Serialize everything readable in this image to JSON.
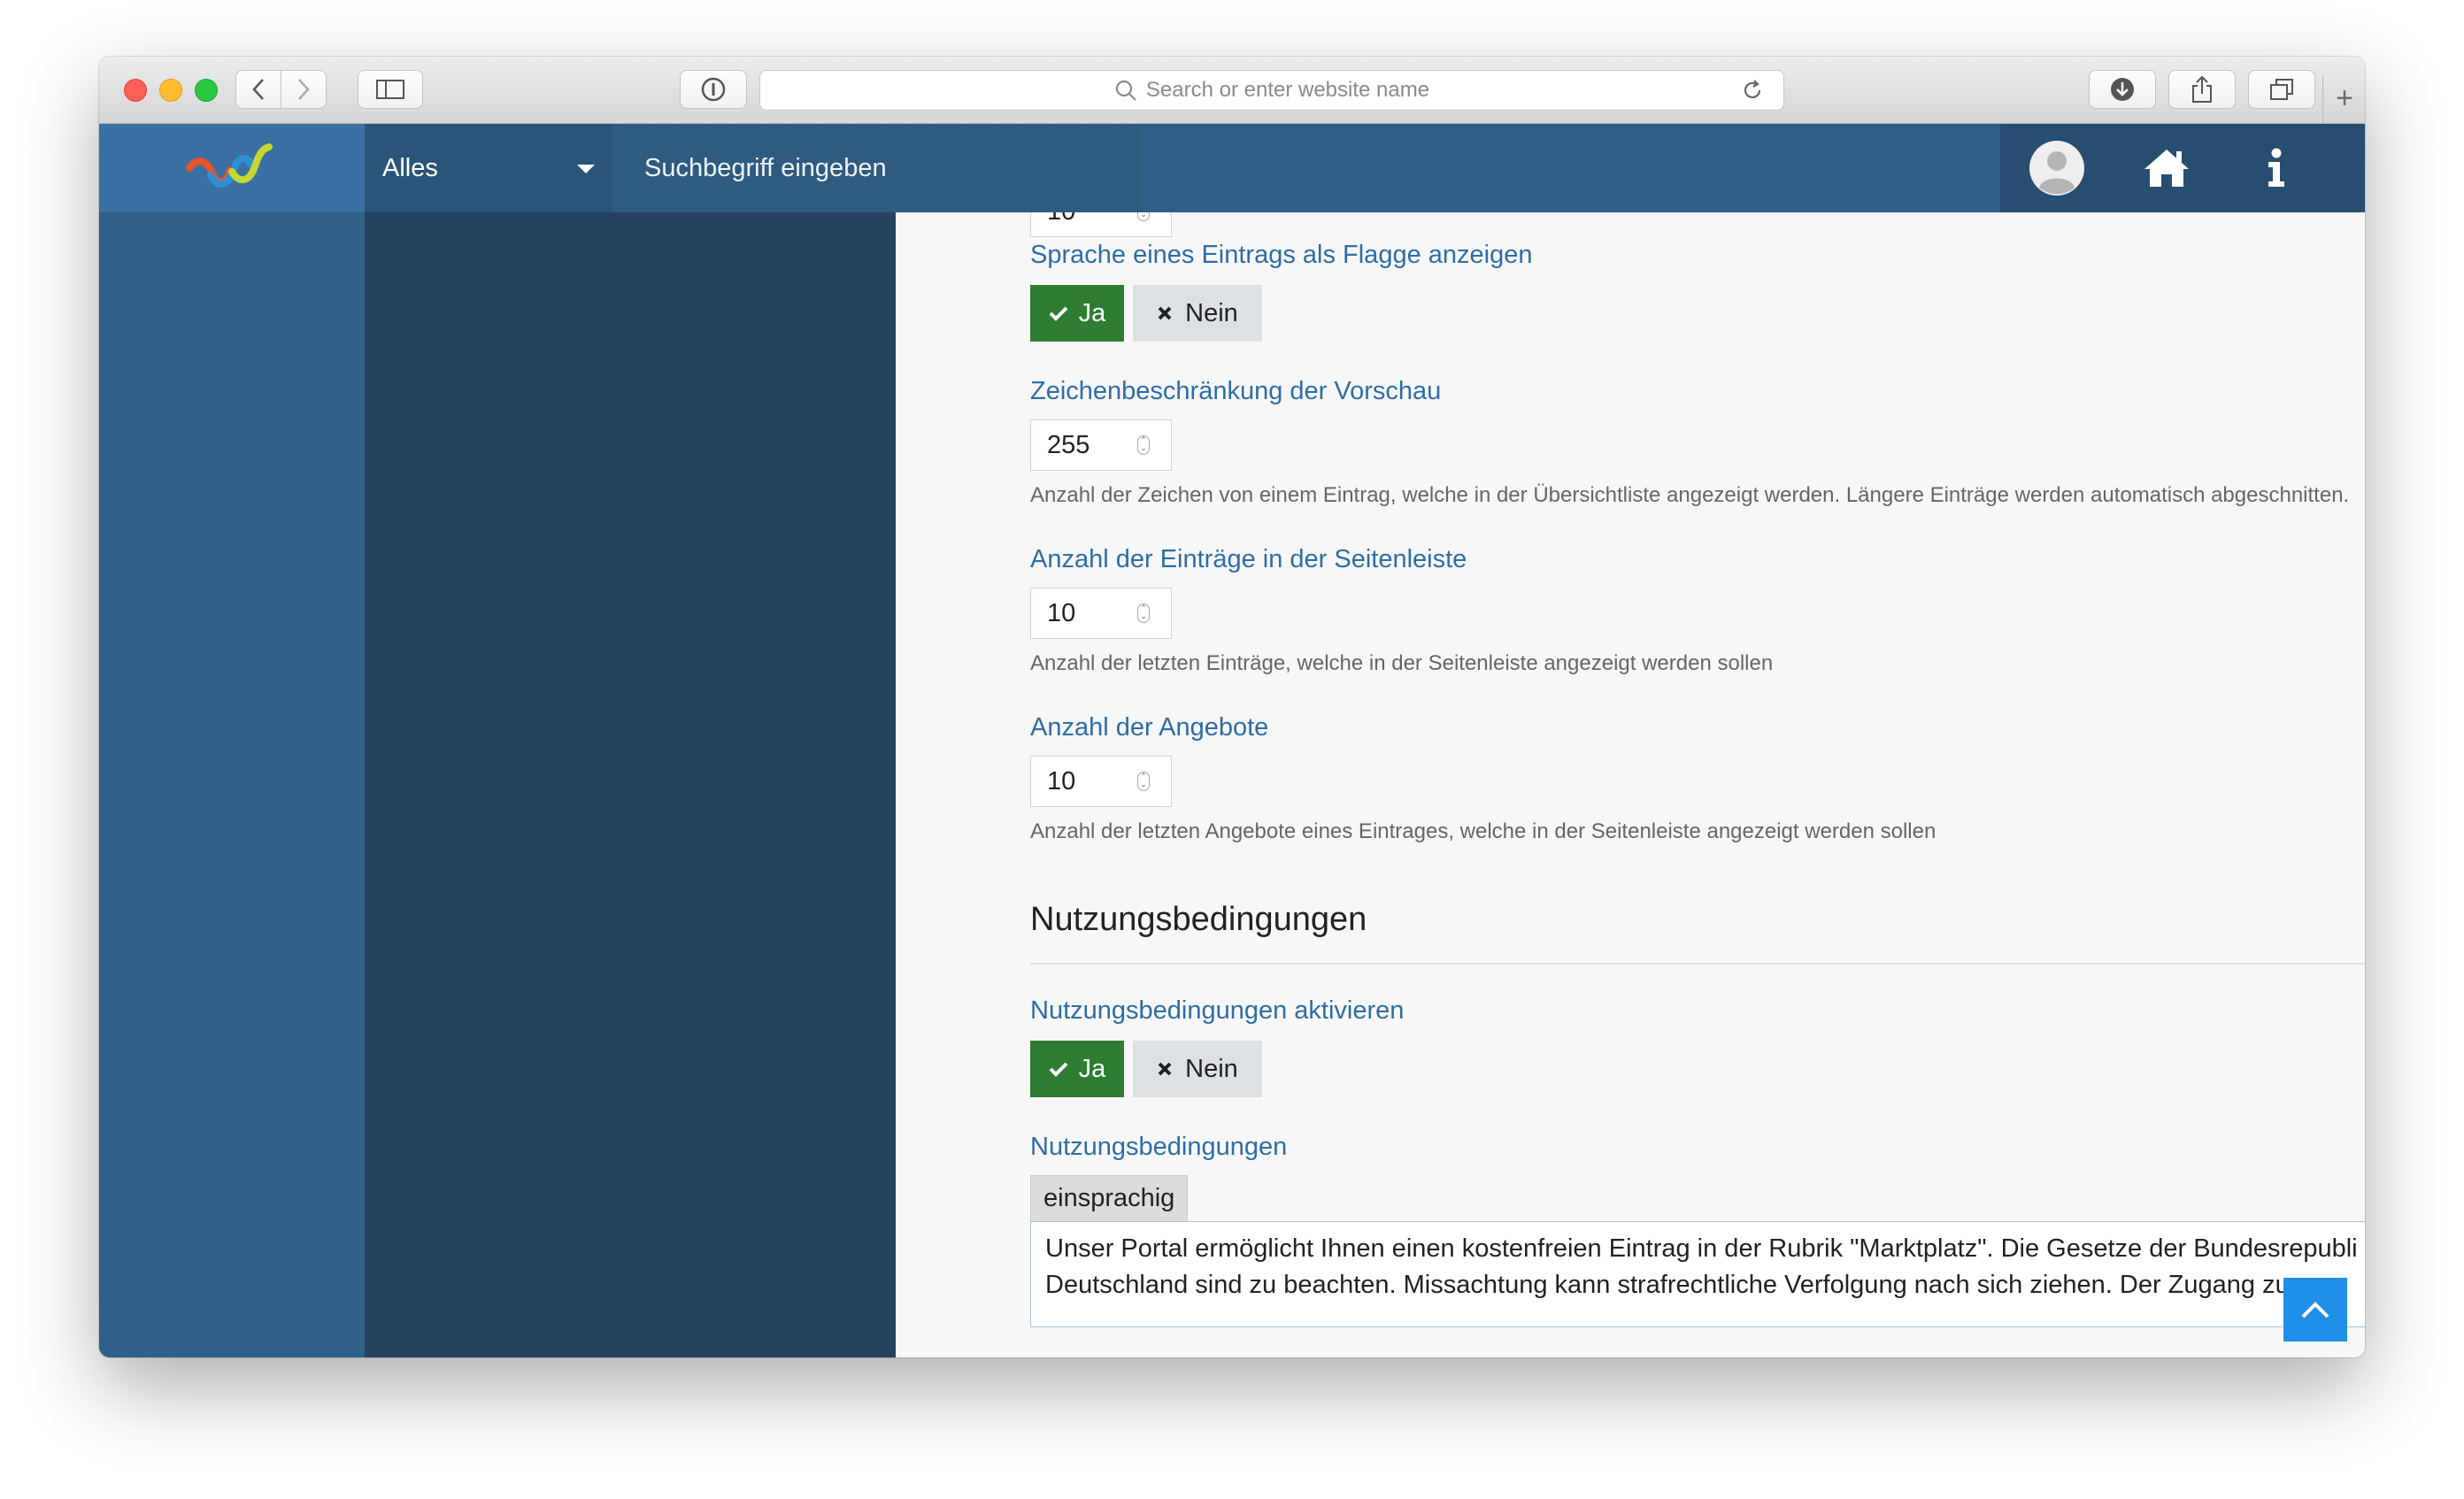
{
  "browser": {
    "url_placeholder": "Search or enter website name"
  },
  "header": {
    "filter_select": "Alles",
    "search_placeholder": "Suchbegriff eingeben"
  },
  "settings": {
    "top_number_value": "10",
    "flag_language": {
      "label": "Sprache eines Eintrags als Flagge anzeigen",
      "yes": "Ja",
      "no": "Nein",
      "selected": "Ja"
    },
    "preview_limit": {
      "label": "Zeichenbeschränkung der Vorschau",
      "value": "255",
      "help": "Anzahl der Zeichen von einem Eintrag, welche in der Übersichtliste angezeigt werden. Längere Einträge werden automatisch abgeschnitten."
    },
    "sidebar_entries": {
      "label": "Anzahl der Einträge in der Seitenleiste",
      "value": "10",
      "help": "Anzahl der letzten Einträge, welche in der Seitenleiste angezeigt werden sollen"
    },
    "offers_count": {
      "label": "Anzahl der Angebote",
      "value": "10",
      "help": "Anzahl der letzten Angebote eines Eintrages, welche in der Seitenleiste angezeigt werden sollen"
    }
  },
  "terms": {
    "section_title": "Nutzungsbedingungen",
    "activate_label": "Nutzungsbedingungen aktivieren",
    "yes": "Ja",
    "no": "Nein",
    "selected": "Ja",
    "text_label": "Nutzungsbedingungen",
    "language_tab": "einsprachig",
    "text_line1": "Unser Portal ermöglicht Ihnen einen kostenfreien Eintrag in der Rubrik \"Marktplatz\". Die Gesetze der Bundesrepubli",
    "text_line2": "Deutschland sind zu beachten. Missachtung kann strafrechtliche Verfolgung nach sich ziehen. Der Zugang zur"
  },
  "colors": {
    "accent_blue": "#2e6da4",
    "yes_green": "#2e7d32",
    "header_blue": "#305f88",
    "nav_dark": "#25425e",
    "scroll_top": "#1f8fe8"
  },
  "icons": [
    "back-icon",
    "forward-icon",
    "sidebar-icon",
    "reader-icon",
    "search-icon",
    "reload-icon",
    "download-icon",
    "share-icon",
    "tabs-icon",
    "user-icon",
    "home-icon",
    "info-icon",
    "check-icon",
    "times-icon",
    "chevron-up-icon"
  ]
}
